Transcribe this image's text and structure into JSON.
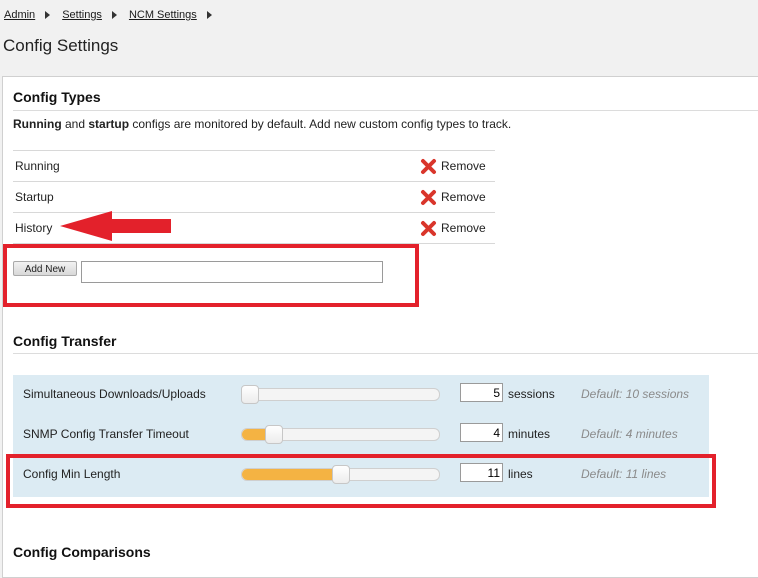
{
  "breadcrumb": {
    "items": [
      "Admin",
      "Settings",
      "NCM Settings"
    ]
  },
  "page_title": "Config Settings",
  "config_types": {
    "title": "Config Types",
    "desc_bold1": "Running",
    "desc_and": " and ",
    "desc_bold2": "startup",
    "desc_rest": " configs are monitored by default. Add new custom config types to track.",
    "rows": [
      {
        "name": "Running",
        "action": "Remove"
      },
      {
        "name": "Startup",
        "action": "Remove"
      },
      {
        "name": "History",
        "action": "Remove"
      }
    ],
    "add_new_label": "Add New",
    "add_new_value": ""
  },
  "config_transfer": {
    "title": "Config Transfer",
    "rows": [
      {
        "label": "Simultaneous Downloads/Uploads",
        "value": "5",
        "unit": "sessions",
        "default": "Default: 10 sessions",
        "level": 0.0
      },
      {
        "label": "SNMP Config Transfer Timeout",
        "value": "4",
        "unit": "minutes",
        "default": "Default: 4 minutes",
        "level": 0.13
      },
      {
        "label": "Config Min Length",
        "value": "11",
        "unit": "lines",
        "default": "Default: 11 lines",
        "level": 0.5
      }
    ]
  },
  "config_comparisons": {
    "title": "Config Comparisons"
  },
  "colors": {
    "highlight": "#e3212b",
    "slider_fill": "#f4b343",
    "transfer_bg": "#dcebf3",
    "remove_icon": "#d9352b"
  }
}
